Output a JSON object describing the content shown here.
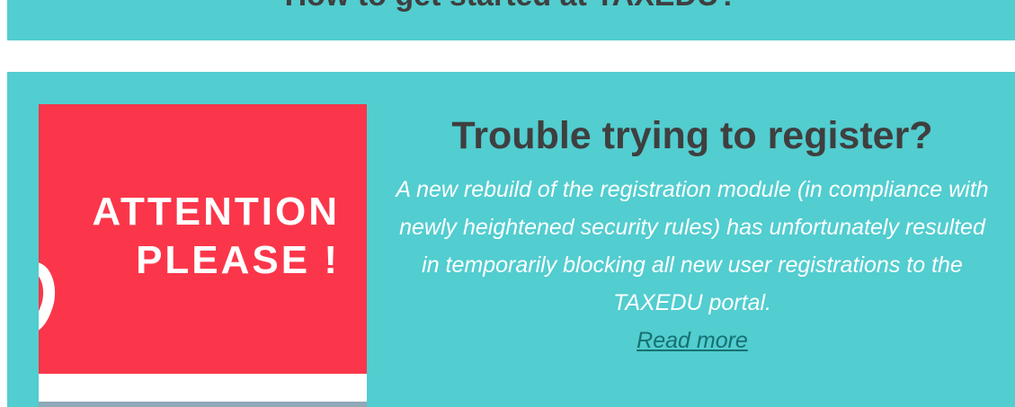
{
  "top_banner": {
    "text": "How to get started at TAXEDU?"
  },
  "notice": {
    "image": {
      "line1": "ATTENTION",
      "line2": "PLEASE !"
    },
    "title": "Trouble trying to register?",
    "body": "A new rebuild of the registration module (in compliance with newly heightened security rules) has unfortunately resulted in temporarily blocking all new user registrations to the TAXEDU portal.",
    "read_more_label": "Read more"
  },
  "colors": {
    "section_background": "#52cdd0",
    "image_red": "#fb364a",
    "title_text": "#3f3f3f",
    "link": "#16706f"
  }
}
